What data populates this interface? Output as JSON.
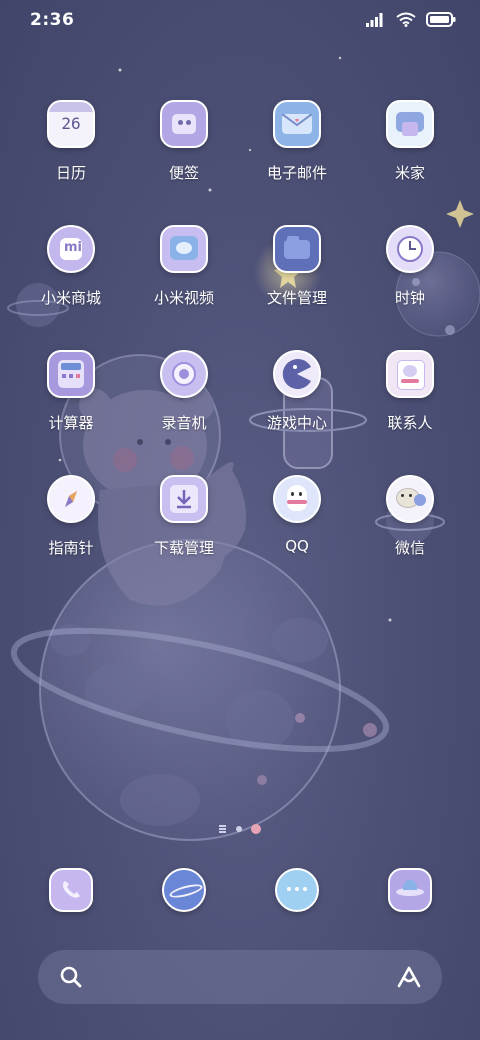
{
  "status_bar": {
    "time": "2:36",
    "icons": [
      "signal-icon",
      "wifi-icon",
      "battery-icon"
    ]
  },
  "apps": [
    {
      "label": "日历",
      "icon": "calendar-icon",
      "date": "26"
    },
    {
      "label": "便签",
      "icon": "notes-icon"
    },
    {
      "label": "电子邮件",
      "icon": "email-icon"
    },
    {
      "label": "米家",
      "icon": "mijia-icon"
    },
    {
      "label": "小米商城",
      "icon": "mi-store-icon"
    },
    {
      "label": "小米视频",
      "icon": "mi-video-icon"
    },
    {
      "label": "文件管理",
      "icon": "file-manager-icon"
    },
    {
      "label": "时钟",
      "icon": "clock-icon"
    },
    {
      "label": "计算器",
      "icon": "calculator-icon"
    },
    {
      "label": "录音机",
      "icon": "recorder-icon"
    },
    {
      "label": "游戏中心",
      "icon": "game-center-icon"
    },
    {
      "label": "联系人",
      "icon": "contacts-icon"
    },
    {
      "label": "指南针",
      "icon": "compass-icon"
    },
    {
      "label": "下载管理",
      "icon": "download-manager-icon"
    },
    {
      "label": "QQ",
      "icon": "qq-icon"
    },
    {
      "label": "微信",
      "icon": "wechat-icon"
    }
  ],
  "dock": [
    {
      "icon": "phone-icon"
    },
    {
      "icon": "planet-icon"
    },
    {
      "icon": "messages-icon"
    },
    {
      "icon": "ufo-icon"
    }
  ],
  "page_indicator": {
    "pages": 3,
    "active": 1
  },
  "search_bar": {
    "left_icon": "search-icon",
    "right_icon": "assistant-icon"
  },
  "colors": {
    "background": "#4d5176",
    "icon_fill": "#f4f2fb",
    "icon_accent": "#a89ad8",
    "label": "#ffffff"
  }
}
